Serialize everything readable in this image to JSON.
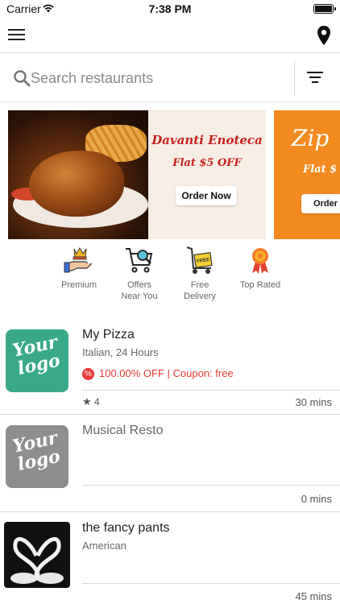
{
  "status_bar": {
    "carrier": "Carrier",
    "time": "7:38 PM"
  },
  "nav": {
    "menu_icon": "hamburger-menu-icon",
    "location_icon": "location-pin-icon"
  },
  "search": {
    "placeholder": "Search restaurants",
    "icon": "search-icon",
    "filter_icon": "filter-icon"
  },
  "banners": [
    {
      "title": "Davanti Enoteca",
      "offer": "Flat $5 OFF",
      "button": "Order Now",
      "background": "#f6eee5",
      "text_color": "#c8201f"
    },
    {
      "title": "Zip",
      "offer": "Flat $",
      "button": "Order",
      "background": "#f28a1f",
      "text_color": "#ffffff"
    }
  ],
  "categories": [
    {
      "label": "Premium",
      "icon": "crown-hand-icon"
    },
    {
      "label": "Offers\nNear You",
      "icon": "shopping-cart-search-icon"
    },
    {
      "label": "Free\nDelivery",
      "icon": "delivery-trolley-icon"
    },
    {
      "label": "Top Rated",
      "icon": "award-ribbon-icon"
    }
  ],
  "restaurants": [
    {
      "name": "My Pizza",
      "cuisine": "Italian, 24 Hours",
      "offer": "100.00% OFF | Coupon: free",
      "rating": "4",
      "delivery_time": "30 mins",
      "logo_text": "Your logo",
      "logo_color": "#3aa989"
    },
    {
      "name": "Musical Resto",
      "cuisine": "",
      "offer": "",
      "rating": "",
      "delivery_time": "0 mins",
      "logo_text": "Your logo",
      "logo_color": "#8e8e8e"
    },
    {
      "name": "the fancy pants",
      "cuisine": "American",
      "offer": "",
      "rating": "",
      "delivery_time": "45 mins",
      "logo_text": "",
      "logo_color": "#111111"
    }
  ],
  "colors": {
    "accent_red": "#e53935",
    "divider": "#d9d9d9"
  }
}
